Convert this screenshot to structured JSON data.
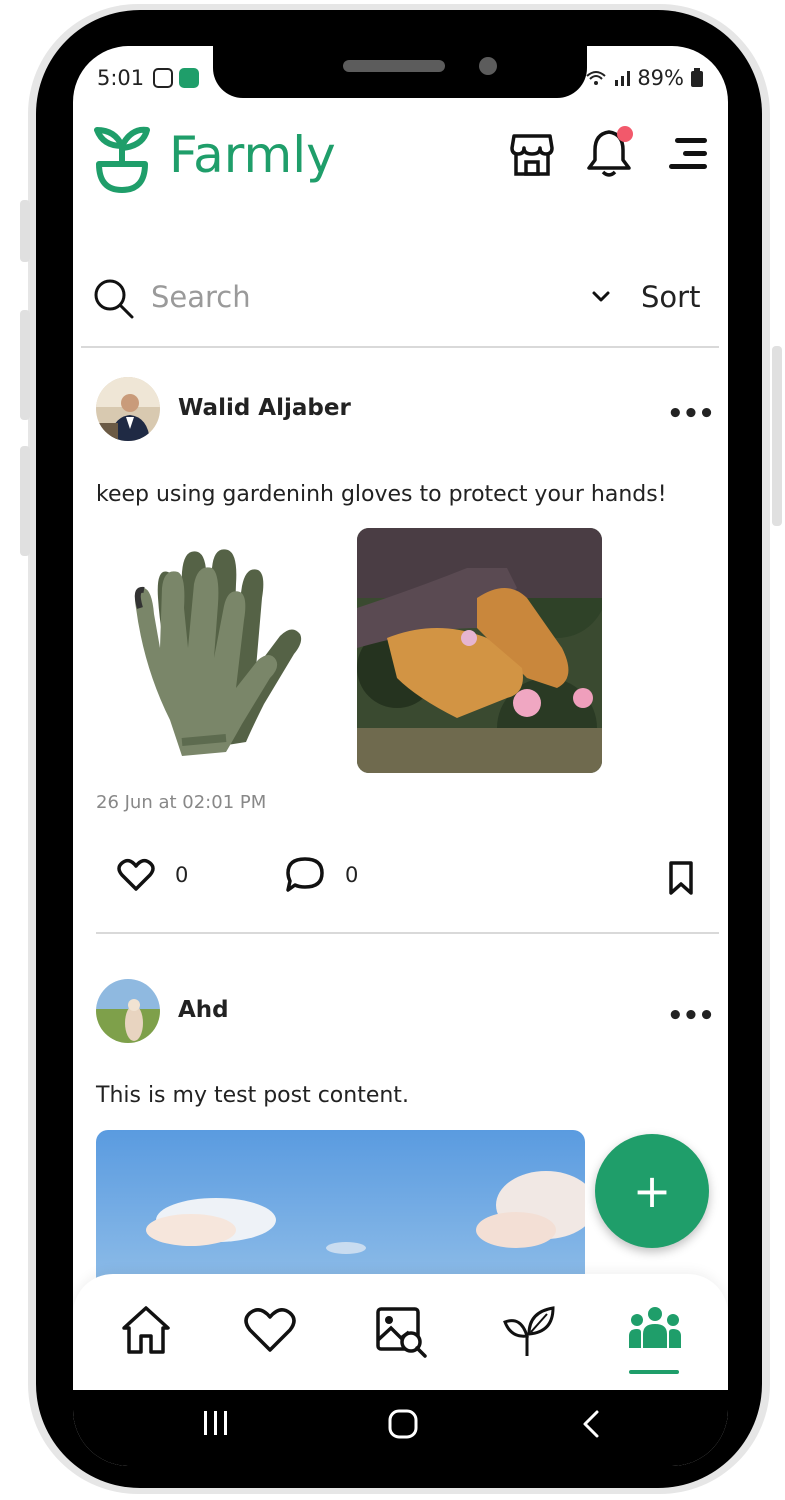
{
  "status_bar": {
    "time": "5:01",
    "battery": "89%"
  },
  "app": {
    "name": "Farmly"
  },
  "header_icons": {
    "shop": "storefront-icon",
    "notifications": "bell-icon",
    "menu": "menu-icon"
  },
  "search": {
    "placeholder": "Search",
    "sort_label": "Sort"
  },
  "posts": [
    {
      "author": "Walid Aljaber",
      "text": "keep using gardeninh gloves to protect your hands!",
      "timestamp": "26 Jun at 02:01 PM",
      "likes": "0",
      "comments": "0"
    },
    {
      "author": "Ahd",
      "text": "This is my test post content."
    }
  ],
  "fab": {
    "label": "+"
  },
  "bottom_nav": [
    "home-icon",
    "heart-icon",
    "image-search-icon",
    "plant-icon",
    "community-icon"
  ],
  "active_tab": "community-icon",
  "colors": {
    "brand": "#1f9e6a",
    "notification_dot": "#f2596b"
  }
}
